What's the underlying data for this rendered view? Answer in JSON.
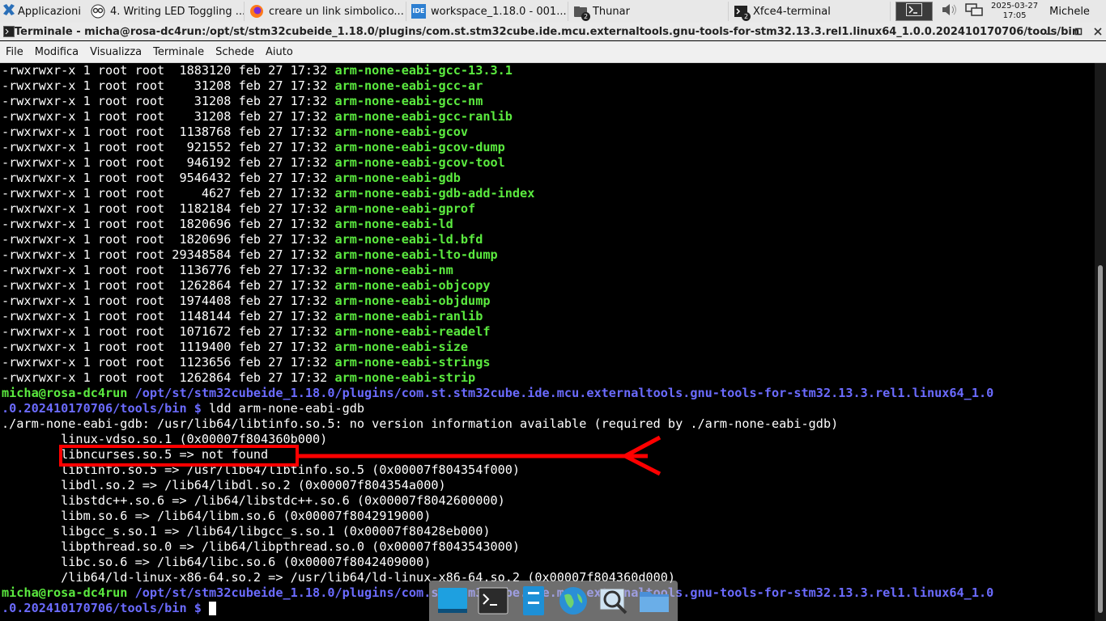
{
  "panel": {
    "apps_label": "Applicazioni",
    "tasks": [
      {
        "label": "4. Writing LED Toggling ...",
        "icon": "owl-icon"
      },
      {
        "label": "creare un link simbolico...",
        "icon": "firefox-icon"
      },
      {
        "label": "workspace_1.18.0 - 001...",
        "icon": "ide-icon",
        "icon_text": "IDE"
      },
      {
        "label": "Thunar",
        "icon": "folder-icon",
        "badge": "2"
      },
      {
        "label": "Xfce4-terminal",
        "icon": "terminal-icon",
        "badge": "2"
      }
    ],
    "date": "2025-03-27",
    "time": "17:05",
    "user": "Michele"
  },
  "window": {
    "title": "Terminale - micha@rosa-dc4run:/opt/st/stm32cubeide_1.18.0/plugins/com.st.stm32cube.ide.mcu.externaltools.gnu-tools-for-stm32.13.3.rel1.linux64_1.0.0.202410170706/tools/bin"
  },
  "menu": [
    "File",
    "Modifica",
    "Visualizza",
    "Terminale",
    "Schede",
    "Aiuto"
  ],
  "listing": [
    {
      "meta": "-rwxrwxr-x 1 root root  1883120 feb 27 17:32 ",
      "name": "arm-none-eabi-gcc-13.3.1"
    },
    {
      "meta": "-rwxrwxr-x 1 root root    31208 feb 27 17:32 ",
      "name": "arm-none-eabi-gcc-ar"
    },
    {
      "meta": "-rwxrwxr-x 1 root root    31208 feb 27 17:32 ",
      "name": "arm-none-eabi-gcc-nm"
    },
    {
      "meta": "-rwxrwxr-x 1 root root    31208 feb 27 17:32 ",
      "name": "arm-none-eabi-gcc-ranlib"
    },
    {
      "meta": "-rwxrwxr-x 1 root root  1138768 feb 27 17:32 ",
      "name": "arm-none-eabi-gcov"
    },
    {
      "meta": "-rwxrwxr-x 1 root root   921552 feb 27 17:32 ",
      "name": "arm-none-eabi-gcov-dump"
    },
    {
      "meta": "-rwxrwxr-x 1 root root   946192 feb 27 17:32 ",
      "name": "arm-none-eabi-gcov-tool"
    },
    {
      "meta": "-rwxrwxr-x 1 root root  9546432 feb 27 17:32 ",
      "name": "arm-none-eabi-gdb"
    },
    {
      "meta": "-rwxrwxr-x 1 root root     4627 feb 27 17:32 ",
      "name": "arm-none-eabi-gdb-add-index"
    },
    {
      "meta": "-rwxrwxr-x 1 root root  1182184 feb 27 17:32 ",
      "name": "arm-none-eabi-gprof"
    },
    {
      "meta": "-rwxrwxr-x 1 root root  1820696 feb 27 17:32 ",
      "name": "arm-none-eabi-ld"
    },
    {
      "meta": "-rwxrwxr-x 1 root root  1820696 feb 27 17:32 ",
      "name": "arm-none-eabi-ld.bfd"
    },
    {
      "meta": "-rwxrwxr-x 1 root root 29348584 feb 27 17:32 ",
      "name": "arm-none-eabi-lto-dump"
    },
    {
      "meta": "-rwxrwxr-x 1 root root  1136776 feb 27 17:32 ",
      "name": "arm-none-eabi-nm"
    },
    {
      "meta": "-rwxrwxr-x 1 root root  1262864 feb 27 17:32 ",
      "name": "arm-none-eabi-objcopy"
    },
    {
      "meta": "-rwxrwxr-x 1 root root  1974408 feb 27 17:32 ",
      "name": "arm-none-eabi-objdump"
    },
    {
      "meta": "-rwxrwxr-x 1 root root  1148144 feb 27 17:32 ",
      "name": "arm-none-eabi-ranlib"
    },
    {
      "meta": "-rwxrwxr-x 1 root root  1071672 feb 27 17:32 ",
      "name": "arm-none-eabi-readelf"
    },
    {
      "meta": "-rwxrwxr-x 1 root root  1119400 feb 27 17:32 ",
      "name": "arm-none-eabi-size"
    },
    {
      "meta": "-rwxrwxr-x 1 root root  1123656 feb 27 17:32 ",
      "name": "arm-none-eabi-strings"
    },
    {
      "meta": "-rwxrwxr-x 1 root root  1262864 feb 27 17:32 ",
      "name": "arm-none-eabi-strip"
    }
  ],
  "prompt": {
    "user": "micha@rosa-dc4run",
    "path_line1": " /opt/st/stm32cubeide_1.18.0/plugins/com.st.stm32cube.ide.mcu.externaltools.gnu-tools-for-stm32.13.3.rel1.linux64_1.0",
    "path_line2": ".0.202410170706/tools/bin",
    "symbol": " $ ",
    "command": "ldd arm-none-eabi-gdb"
  },
  "prompt2_visible": "naltools.gnu-tools-for-stm32.13.3.rel1.linux64_1.0",
  "ldd_output": [
    "./arm-none-eabi-gdb: /usr/lib64/libtinfo.so.5: no version information available (required by ./arm-none-eabi-gdb)",
    "        linux-vdso.so.1 (0x00007f804360b000)",
    "        libncurses.so.5 => not found",
    "        libtinfo.so.5 => /usr/lib64/libtinfo.so.5 (0x00007f804354f000)",
    "        libdl.so.2 => /lib64/libdl.so.2 (0x00007f804354a000)",
    "        libstdc++.so.6 => /lib64/libstdc++.so.6 (0x00007f8042600000)",
    "        libm.so.6 => /lib64/libm.so.6 (0x00007f8042919000)",
    "        libgcc_s.so.1 => /lib64/libgcc_s.so.1 (0x00007f80428eb000)",
    "        libpthread.so.0 => /lib64/libpthread.so.0 (0x00007f8043543000)",
    "        libc.so.6 => /lib64/libc.so.6 (0x00007f8042409000)",
    "        /lib64/ld-linux-x86-64.so.2 => /usr/lib64/ld-linux-x86-64.so.2 (0x00007f804360d000)"
  ],
  "dock": [
    "desktop-icon",
    "terminal-icon",
    "file-manager-icon",
    "web-browser-icon",
    "search-icon",
    "folder-icon"
  ],
  "colors": {
    "green": "#5bea3f",
    "blue": "#6b6bff",
    "highlight": "#ff0000"
  }
}
